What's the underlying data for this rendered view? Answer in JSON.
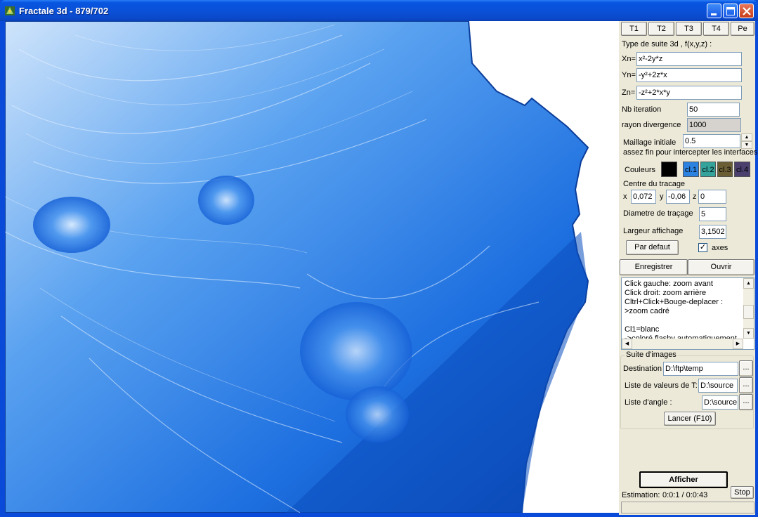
{
  "window": {
    "title": "Fractale 3d - 879/702"
  },
  "tabs": [
    "T1",
    "T2",
    "T3",
    "T4",
    "Pe"
  ],
  "formula": {
    "heading": "Type de suite 3d , f(x,y,z) :",
    "xn_label": "Xn=",
    "xn_value": "x²-2y*z",
    "yn_label": "Yn=",
    "yn_value": "-y²+2z*x",
    "zn_label": "Zn=",
    "zn_value": "-z²+2*x*y"
  },
  "params": {
    "iteration_label": "Nb iteration",
    "iteration_value": "50",
    "divergence_label": "rayon divergence",
    "divergence_value": "1000",
    "maillage_label": "Maillage initiale",
    "maillage_value": "0.5",
    "maillage_hint": "assez fin pour intercepter les interfaces"
  },
  "colors": {
    "label": "Couleurs",
    "swatches": [
      {
        "label": "",
        "color": "#000000"
      },
      {
        "label": "cl.1",
        "color": "#2b82e0"
      },
      {
        "label": "cl.2",
        "color": "#33a39b"
      },
      {
        "label": "cl.3",
        "color": "#6b5e34"
      },
      {
        "label": "cl.4",
        "color": "#4a3f6d"
      }
    ]
  },
  "center": {
    "heading": "Centre du tracage",
    "x_label": "x",
    "x_value": "0,072",
    "y_label": "y",
    "y_value": "-0,06",
    "z_label": "z",
    "z_value": "0"
  },
  "diameter": {
    "label": "Diametre de traçage",
    "value": "5"
  },
  "largeur": {
    "label": "Largeur affichage",
    "value": "3,1502"
  },
  "defaults_button": "Par defaut",
  "axes_checkbox": {
    "label": "axes",
    "checked": true
  },
  "file_buttons": {
    "save": "Enregistrer",
    "open": "Ouvrir"
  },
  "help_text": [
    "Click gauche: zoom avant",
    "Click droit: zoom arrière",
    "Cltrl+Click+Bouge-deplacer :",
    "   >zoom cadré",
    "",
    "Cl1=blanc",
    "->coloré flashy automatiquement"
  ],
  "image_series": {
    "heading": "Suite d'images",
    "destination_label": "Destination",
    "destination_value": "D:\\ftp\\temp",
    "values_label": "Liste de valeurs de T:",
    "values_value": "D:\\source",
    "angle_label": "Liste d'angle :",
    "angle_value": "D:\\source",
    "browse_label": "...",
    "launch_button": "Lancer (F10)"
  },
  "bottom": {
    "show_button": "Afficher",
    "stop_button": "Stop",
    "estimation_label": "Estimation:",
    "estimation_value": "0:0:1 / 0:0:43"
  }
}
